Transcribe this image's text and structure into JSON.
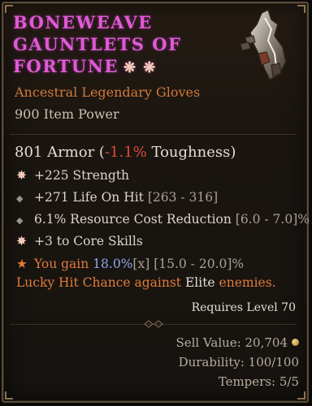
{
  "item": {
    "name_lines": [
      "BONEWEAVE",
      "GAUNTLETS OF",
      "FORTUNE"
    ],
    "legendary_marks": "❋ ❋",
    "type": "Ancestral Legendary Gloves",
    "item_power": "900 Item Power"
  },
  "armor": {
    "prefix": "801 Armor (",
    "change": "-1.1%",
    "suffix": " Toughness)"
  },
  "affixes": [
    {
      "bullet": "✸",
      "text": "+225 Strength",
      "range": ""
    },
    {
      "bullet": "◆",
      "text": "+271 Life On Hit",
      "range": " [263 - 316]"
    },
    {
      "bullet": "◆",
      "text": "6.1% Resource Cost Reduction",
      "range": " [6.0 - 7.0]%"
    },
    {
      "bullet": "✸",
      "text": "+3 to Core Skills",
      "range": ""
    }
  ],
  "aspect": {
    "bullet": "★",
    "t1": "You gain ",
    "roll": "18.0%",
    "x": "[x]",
    "range": " [15.0 - 20.0]% ",
    "t2": "Lucky Hit Chance against ",
    "elite": "Elite",
    "t3": " enemies."
  },
  "requirements": "Requires Level 70",
  "footer": {
    "sell_value": "Sell Value: 20,704",
    "durability": "Durability: 100/100",
    "tempers": "Tempers: 5/5"
  },
  "colors": {
    "title": "#e05ad6",
    "legendary": "#d07a3c",
    "negative": "#e04a3a",
    "roll_value": "#8fa8e8"
  },
  "icons": {
    "item_art": "gauntlet-icon",
    "greater_affix": "starburst-icon",
    "affix": "diamond-icon",
    "aspect": "star-icon",
    "coin": "gold-coin-icon"
  }
}
